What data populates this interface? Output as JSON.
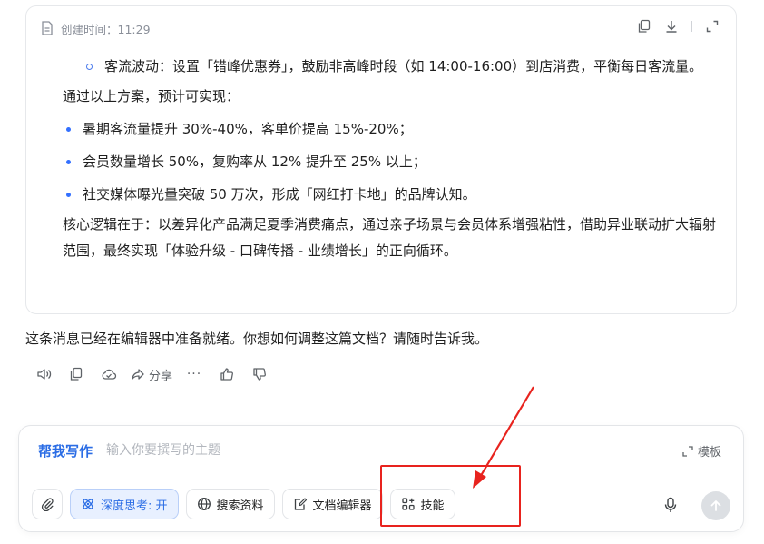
{
  "doc": {
    "created_label": "创建时间：11:29",
    "sub_item": "客流波动：设置「错峰优惠券」，鼓励非高峰时段（如 14:00-16:00）到店消费，平衡每日客流量。",
    "intro": "通过以上方案，预计可实现：",
    "bullets": [
      "暑期客流量提升 30%-40%，客单价提高 15%-20%；",
      "会员数量增长 50%，复购率从 12% 提升至 25% 以上；",
      "社交媒体曝光量突破 50 万次，形成「网红打卡地」的品牌认知。"
    ],
    "summary": "核心逻辑在于：以差异化产品满足夏季消费痛点，通过亲子场景与会员体系增强粘性，借助异业联动扩大辐射范围，最终实现「体验升级 - 口碑传播 - 业绩增长」的正向循环。"
  },
  "message": "这条消息已经在编辑器中准备就绪。你想如何调整这篇文档？请随时告诉我。",
  "actions": {
    "share_label": "分享",
    "more_label": "···"
  },
  "composer": {
    "mode_label": "帮我写作",
    "placeholder": "输入你要撰写的主题",
    "template_label": "模板",
    "chips": {
      "deep_think": "深度思考: 开",
      "search": "搜索资料",
      "doc_editor": "文档编辑器",
      "skills": "技能"
    }
  },
  "colors": {
    "accent": "#2b6de5",
    "annotation": "#e8231e"
  }
}
